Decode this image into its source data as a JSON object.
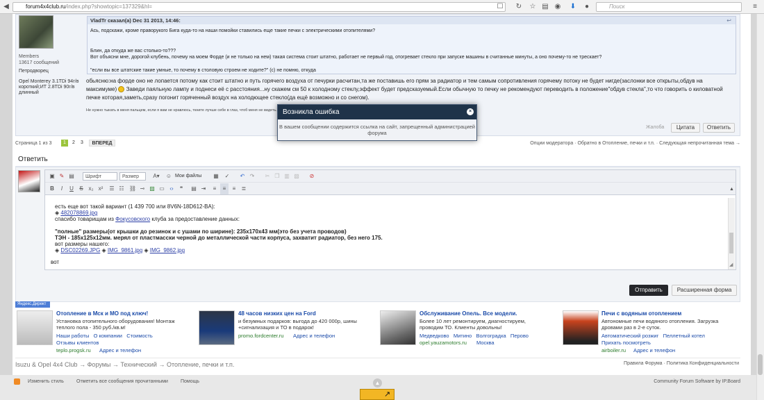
{
  "browser": {
    "url_host": "forum4x4club.ru",
    "url_path": "/index.php?showtopic=137329&hl=",
    "search_placeholder": "Поиск",
    "colors": {
      "toolbar": "#f2f2f2"
    }
  },
  "post": {
    "user": {
      "group": "Members",
      "posts": "13617 сообщений",
      "city": "Петродворец",
      "cars": "Opel Monterey 3.1TDi 94г/в короткий;ИТ 2.8TDi 90г/в длинный"
    },
    "quote": {
      "header": "VladTr сказал(а) Dec 31 2013, 14:46:",
      "line1": "Ась, подскажи, кроме праворукого Бига куда-то на наши помойки ставились еще такие печки с электрическими отопителями?",
      "line2": "Блин, да откуда же вас столько-то???",
      "line3": "Вот объясни мне, дорогой клубень, почему на моем Форде (и не только на нем) такая система стоит штатно, работает не первый год, отогревает стекло при запуске машины в считанные минуты, а оно почему-то не трескает?",
      "line4": "\"если вы все штатские такие умные, то почему в столовую строем не ходите?\" (с) не помню, откуда"
    },
    "text1": "обьясню:на форде оно не лопается потому как стоит штатно и путь горячего воздуха от печурки расчитан,та же поставишь его прям за радиатор и тем самым сопротивления горячему потоку не будет нигде(заслонки все открыты,обдув на",
    "text2a": "максимуме)",
    "text2b": "Заведи паяльную лампу и поднеси её с расстояния...ну скажем см 50 к холодному стеклу,эффект будет предсказуемый.Если обычную то печку не рекомендуют переводить в положение\"обдув стекла\",то что говорить о киловатной",
    "text3": "печке которая,заметь,сразу погонит горяченный воздух на холодющее стекло(да ещё возможно и со снегом).",
    "signature": "Не нужно тыкать в меня пальцем, если я вам не нравлюсь, ткните лучше себе в глаз, чтоб меня не видеть.",
    "report_label": "Жалоба",
    "quote_btn": "Цитата",
    "reply_btn": "Ответить"
  },
  "pagination": {
    "label": "Страница 1 из 3",
    "pages": [
      "1",
      "2",
      "3"
    ],
    "next": "ВПЕРЕД",
    "right_links": "Опции модератора · Обратно в Отопление, печки и т.п. · Следующая непрочитанная тема →"
  },
  "reply": {
    "title": "Ответить",
    "font_select": "Шрифт",
    "size_select": "Размер",
    "myfiles": "Мои файлы",
    "content": {
      "l1": "есть еще вот такой вариант (1 439 700 или 8V6N-18D612-BA):",
      "l2_link": "482078869.jpg",
      "l3a": "спасибо товарищам из ",
      "l3_link": "Фокусовского",
      "l3b": " клуба за предоставление данных:",
      "l4": "\"полные\" размеры(от крышки до резинок и с ушами по ширине): 235x170x43 мм(это без учета проводов)",
      "l5": "ТЭН - 185x125x12мм. мерял от пластмасски черной до металлической части корпуса, захватит радиатор, без него 175.",
      "l6": "вот размеры нашего:",
      "l7_link1": "DSC02269.JPG",
      "l7_link2": "IMG_9861.jpg",
      "l7_link3": "IMG_9862.jpg",
      "l8": "вот"
    },
    "send_btn": "Отправить",
    "advanced_btn": "Расширенная форма"
  },
  "ads": {
    "tag": "Яндекс.Директ",
    "items": [
      {
        "title": "Отопление в Мск и МО под ключ!",
        "text": "Установка отопительного оборудования! Монтаж теплого пола - 350 руб./кв.м!",
        "links": "Наши работы   О компании   Стоимость",
        "links2": "Отзывы клиентов",
        "domain": "teplo.progsk.ru",
        "addr": "Адрес и телефон"
      },
      {
        "title": "48 часов низких цен на Ford",
        "text": "и безумных подарков: выгода до 420 000р, шины +сигнализация и ТО в подарок!",
        "links": "",
        "links2": "",
        "domain": "promo.fordcenter.ru",
        "addr": "Адрес и телефон"
      },
      {
        "title": "Обслуживание Опель. Все модели.",
        "text": "Более 10 лет ремонтируем, диагностируем, проводим ТО. Клиенты довольны!",
        "links": "Медведково   Митино   Волгоградка   Перово",
        "links2": "",
        "domain": "opel.yauzamotors.ru",
        "addr": "Москва"
      },
      {
        "title": "Печи с водяным отоплением",
        "text": "Автономные печи водяного отопления. Загрузка дровами раз в 2-е суток.",
        "links": "Автоматический розжиг   Пеллетный котел",
        "links2": "Прихать посмотреть",
        "domain": "airboiler.ru",
        "addr": "Адрес и телефон"
      }
    ]
  },
  "breadcrumb": {
    "items": [
      "Isuzu & Opel 4x4 Club",
      "Форумы",
      "Технический",
      "Отопление, печки и т.п."
    ],
    "right": "Правила Форума · Политика Конфиденциальности"
  },
  "footer": {
    "change_style": "Изменить стиль",
    "mark_read": "Отметить все сообщения прочитанными",
    "help": "Помощь",
    "powered": "Community Forum Software by IP.Board"
  },
  "modal": {
    "title": "Возникла ошибка",
    "message": "В вашем сообщении содержится ссылка на сайт, запрещенный администрацией форума"
  }
}
